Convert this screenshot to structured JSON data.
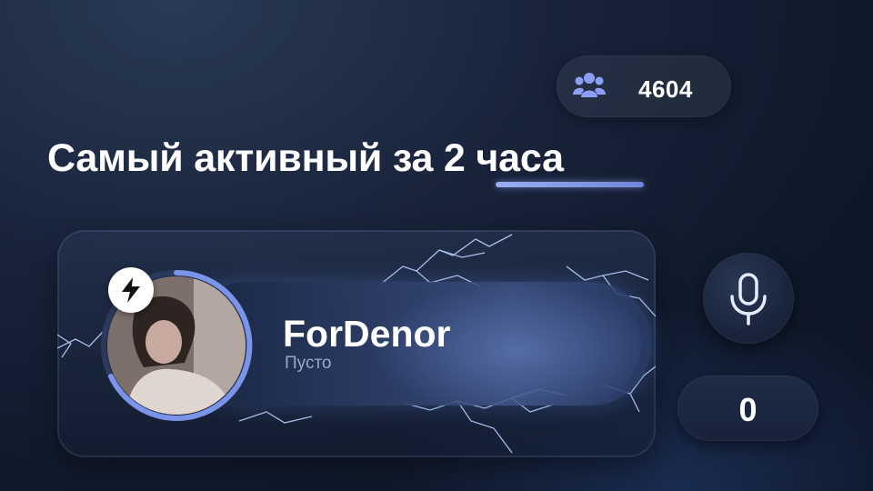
{
  "members": {
    "icon": "group-icon",
    "count": "4604"
  },
  "heading": {
    "prefix": "Самый активный за ",
    "accent": "2 часа"
  },
  "user": {
    "name": "ForDenor",
    "status": "Пусто",
    "badge_icon": "lightning-icon",
    "avatar": "avatar-icon"
  },
  "voice": {
    "icon": "microphone-icon",
    "count": "0"
  },
  "colors": {
    "accent": "#7b93e8",
    "member_icon": "#8c9ef5",
    "background": "#131d31"
  }
}
